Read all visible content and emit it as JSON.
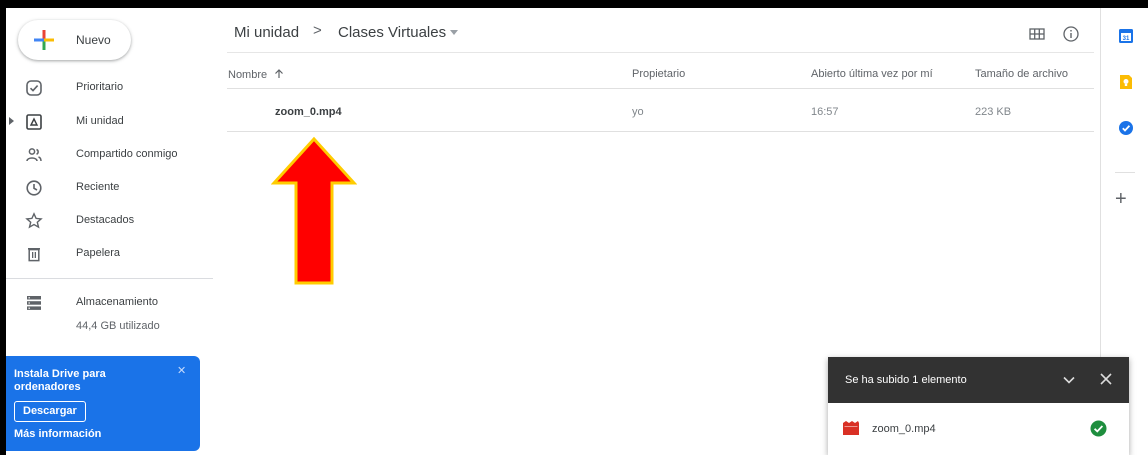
{
  "sidebar": {
    "new_button": "Nuevo",
    "items": [
      {
        "label": "Prioritario",
        "icon": "check-circle-icon"
      },
      {
        "label": "Mi unidad",
        "icon": "drive-icon"
      },
      {
        "label": "Compartido conmigo",
        "icon": "shared-people-icon"
      },
      {
        "label": "Reciente",
        "icon": "clock-icon"
      },
      {
        "label": "Destacados",
        "icon": "star-icon"
      },
      {
        "label": "Papelera",
        "icon": "trash-icon"
      }
    ],
    "storage": {
      "label": "Almacenamiento",
      "used": "44,4 GB utilizado"
    },
    "promo": {
      "title": "Instala Drive para ordenadores",
      "button": "Descargar",
      "link": "Más información"
    }
  },
  "breadcrumb": {
    "root": "Mi unidad",
    "separator": ">",
    "current": "Clases Virtuales"
  },
  "table": {
    "headers": {
      "name": "Nombre",
      "owner": "Propietario",
      "opened": "Abierto última vez por mí",
      "size": "Tamaño de archivo"
    },
    "rows": [
      {
        "name": "zoom_0.mp4",
        "owner": "yo",
        "opened": "16:57",
        "size": "223 KB"
      }
    ]
  },
  "upload_toast": {
    "title": "Se ha subido 1 elemento",
    "file": "zoom_0.mp4"
  },
  "colors": {
    "accent": "#1a73e8",
    "arrow_fill": "#ff0000",
    "arrow_border": "#ffcc00",
    "toast_header": "#323232",
    "success": "#1e8e3e"
  }
}
